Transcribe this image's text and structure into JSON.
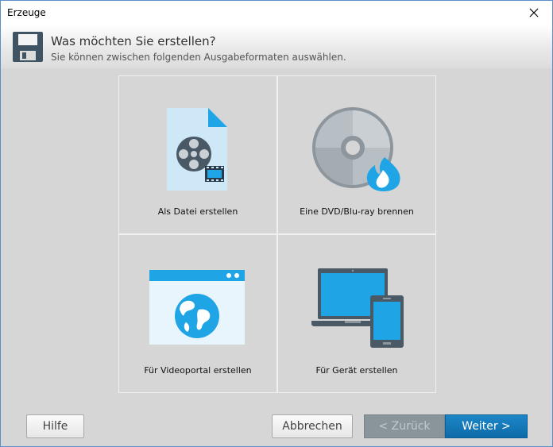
{
  "window": {
    "title": "Erzeuge"
  },
  "header": {
    "title": "Was möchten Sie erstellen?",
    "subtitle": "Sie können zwischen folgenden Ausgabeformaten auswählen."
  },
  "options": [
    {
      "label": "Als Datei erstellen",
      "icon": "film-file-icon"
    },
    {
      "label": "Eine DVD/Blu-ray brennen",
      "icon": "disc-burn-icon"
    },
    {
      "label": "Für Videoportal erstellen",
      "icon": "web-globe-icon"
    },
    {
      "label": "Für Gerät erstellen",
      "icon": "laptop-tablet-icon"
    }
  ],
  "buttons": {
    "help": "Hilfe",
    "cancel": "Abbrechen",
    "back": "< Zurück",
    "next": "Weiter >"
  },
  "colors": {
    "accent": "#1479bd",
    "disabled": "#8a949b",
    "icon_blue": "#1fa5e6",
    "icon_dark": "#4a5966"
  }
}
